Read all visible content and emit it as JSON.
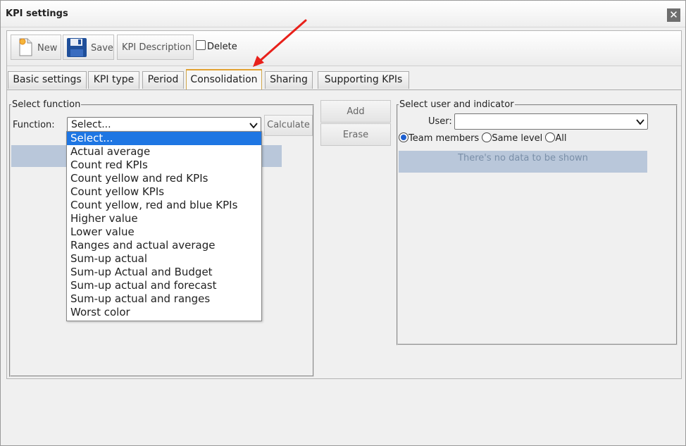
{
  "window": {
    "title": "KPI settings",
    "close_symbol": "✕"
  },
  "toolbar": {
    "new_label": "New",
    "save_label": "Save",
    "kpi_description_label": "KPI Description",
    "delete_label": "Delete"
  },
  "tabs": [
    {
      "label": "Basic settings"
    },
    {
      "label": "KPI type"
    },
    {
      "label": "Period"
    },
    {
      "label": "Consolidation"
    },
    {
      "label": "Sharing"
    },
    {
      "label": "Supporting KPIs"
    }
  ],
  "active_tab": "Consolidation",
  "left_panel": {
    "legend": "Select function",
    "function_label": "Function:",
    "function_value": "Select...",
    "calculate_label": "Calculate",
    "options": [
      "Select...",
      "Actual average",
      "Count red KPIs",
      "Count yellow and red KPIs",
      "Count yellow KPIs",
      "Count yellow, red and blue KPIs",
      "Higher value",
      "Lower value",
      "Ranges and actual average",
      "Sum-up actual",
      "Sum-up Actual and Budget",
      "Sum-up actual and forecast",
      "Sum-up actual and ranges",
      "Worst color"
    ]
  },
  "middle": {
    "add_label": "Add",
    "erase_label": "Erase"
  },
  "right_panel": {
    "legend": "Select user and indicator",
    "user_label": "User:",
    "user_value": "",
    "radio_team": "Team members",
    "radio_same": "Same level",
    "radio_all": "All",
    "no_data": "There's no data to be shown"
  },
  "colors": {
    "selection_blue": "#1e76e3",
    "nodata_bg": "#b9c7da",
    "active_tab_border": "#e2a233",
    "annotation_arrow": "#e8201a"
  }
}
